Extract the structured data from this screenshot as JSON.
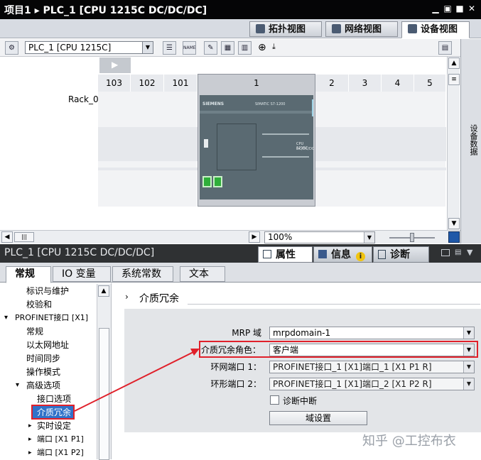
{
  "window": {
    "title": "项目1 ▸ PLC_1 [CPU 1215C DC/DC/DC]",
    "minimize": "▁",
    "restore": "▣",
    "maximize": "■",
    "close": "✕"
  },
  "view_tabs": [
    {
      "label": "拓扑视图",
      "icon": "topology-icon"
    },
    {
      "label": "网络视图",
      "icon": "network-icon"
    },
    {
      "label": "设备视图",
      "icon": "device-icon"
    }
  ],
  "toolbar": {
    "device_select": "PLC_1 [CPU 1215C]",
    "zoom_glyph": "⊕",
    "name_btn": "NAME"
  },
  "rack": {
    "label": "Rack_0",
    "slots": [
      "103",
      "102",
      "101",
      "1",
      "2",
      "3",
      "4",
      "5"
    ]
  },
  "cpu": {
    "brand": "SIEMENS",
    "model_short": "SIMATIC S7-1200",
    "model_line1": "CPU 1215C",
    "model_line2": "DC/DC/DC"
  },
  "zoom": {
    "value": "100%"
  },
  "right_panel": {
    "label": "设备数据"
  },
  "inspector": {
    "title": "PLC_1 [CPU 1215C DC/DC/DC]",
    "tabs": [
      {
        "label": "属性",
        "icon": "properties-icon"
      },
      {
        "label": "信息",
        "icon": "info-icon"
      },
      {
        "label": "诊断",
        "icon": "diagnostics-icon"
      }
    ]
  },
  "property_tabs": [
    "常规",
    "IO 变量",
    "系统常数",
    "文本"
  ],
  "tree": [
    {
      "label": "标识与维护",
      "indent": 2,
      "arrow": ""
    },
    {
      "label": "校验和",
      "indent": 2,
      "arrow": ""
    },
    {
      "label": "PROFINET接口 [X1]",
      "indent": 0,
      "arrow": "▾"
    },
    {
      "label": "常规",
      "indent": 2,
      "arrow": ""
    },
    {
      "label": "以太网地址",
      "indent": 2,
      "arrow": ""
    },
    {
      "label": "时间同步",
      "indent": 2,
      "arrow": ""
    },
    {
      "label": "操作模式",
      "indent": 2,
      "arrow": ""
    },
    {
      "label": "高级选项",
      "indent": 1,
      "arrow": "▾"
    },
    {
      "label": "接口选项",
      "indent": 3,
      "arrow": ""
    },
    {
      "label": "介质冗余",
      "indent": 3,
      "arrow": "",
      "selected": true
    },
    {
      "label": "实时设定",
      "indent": 2,
      "arrow": "▸"
    },
    {
      "label": "端口 [X1 P1]",
      "indent": 2,
      "arrow": "▸"
    },
    {
      "label": "端口 [X1 P2]",
      "indent": 2,
      "arrow": "▸"
    }
  ],
  "section": {
    "title": "介质冗余",
    "arrow": "›"
  },
  "form": {
    "mrp_label": "MRP 域",
    "mrp_value": "mrpdomain-1",
    "role_label": "介质冗余角色：",
    "role_value": "客户端",
    "port1_label": "环网端口 1：",
    "port1_value": "PROFINET接口_1 [X1]端口_1 [X1 P1 R]",
    "port2_label": "环形端口 2：",
    "port2_value": "PROFINET接口_1 [X1]端口_2 [X1 P2 R]",
    "diag_label": "诊断中断",
    "domain_btn": "域设置"
  },
  "watermark": "知乎 @工控布衣",
  "colors": {
    "title_bar": "#050506",
    "highlight": "#e0202a",
    "selection": "#3072c9"
  }
}
